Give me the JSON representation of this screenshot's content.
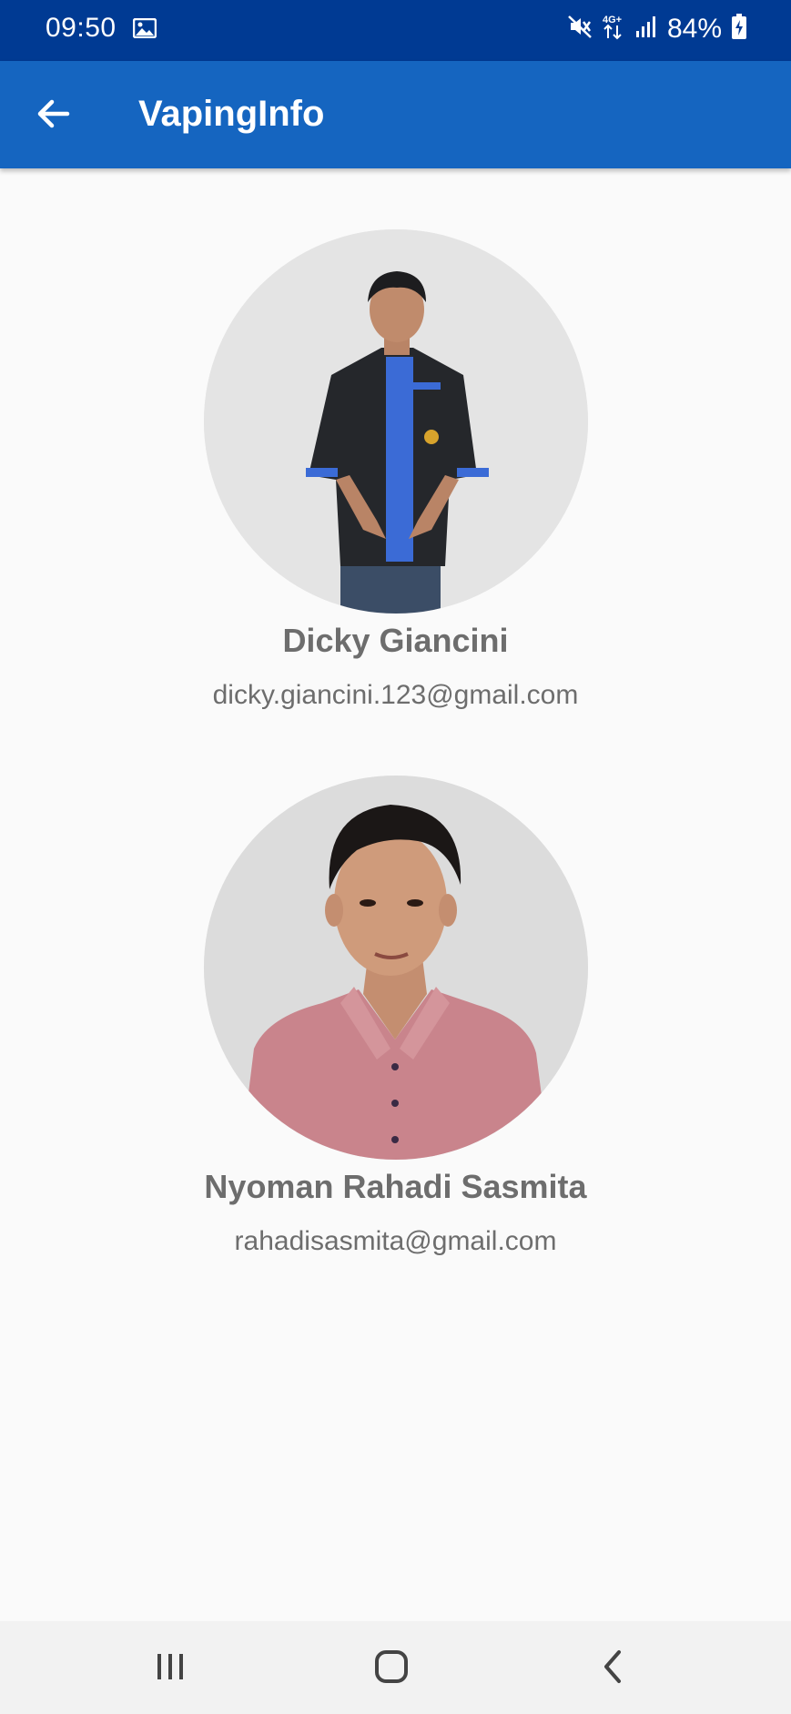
{
  "status_bar": {
    "time": "09:50",
    "battery": "84%",
    "icons": [
      "image-icon",
      "mute-icon",
      "network-4g-icon",
      "signal-icon",
      "battery-charging-icon"
    ]
  },
  "app_bar": {
    "title": "VapingInfo",
    "back_icon": "arrow-left-icon"
  },
  "profiles": [
    {
      "name": "Dicky Giancini",
      "email": "dicky.giancini.123@gmail.com"
    },
    {
      "name": "Nyoman Rahadi Sasmita",
      "email": "rahadisasmita@gmail.com"
    }
  ],
  "nav_bar": {
    "icons": [
      "recent-apps-icon",
      "home-icon",
      "back-icon"
    ]
  },
  "colors": {
    "status_bar": "#003a93",
    "app_bar": "#1565c0",
    "background": "#fafafa",
    "text": "#6d6d6d"
  }
}
